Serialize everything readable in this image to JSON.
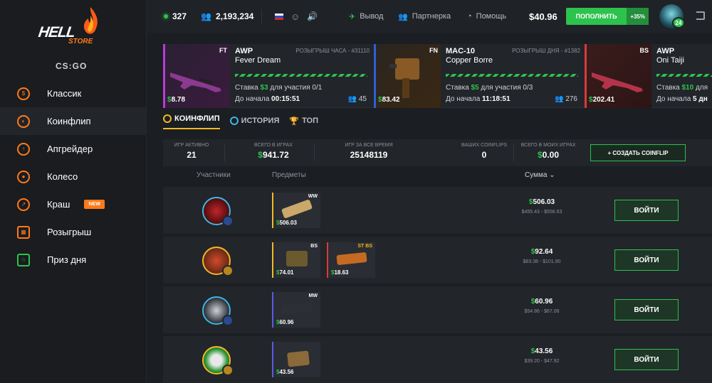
{
  "brand": {
    "logo_hell": "HELL",
    "logo_store": "STORE",
    "game": "CS:GO"
  },
  "sidebar": {
    "items": [
      {
        "label": "Классик"
      },
      {
        "label": "Коинфлип"
      },
      {
        "label": "Апгрейдер"
      },
      {
        "label": "Колесо"
      },
      {
        "label": "Краш",
        "badge": "NEW"
      },
      {
        "label": "Розыгрыш"
      },
      {
        "label": "Приз дня"
      }
    ]
  },
  "topbar": {
    "online": "327",
    "users": "2,193,234",
    "withdraw": "Вывод",
    "partner": "Партнерка",
    "help": "Помощь",
    "balance": "$40.96",
    "deposit_label": "ПОПОЛНИТЬ",
    "deposit_bonus": "+35%",
    "level": "24"
  },
  "giveaways": [
    {
      "wear": "FT",
      "price": "8.78",
      "name": "AWP",
      "skin": "Fever Dream",
      "type": "РОЗЫГРЫШ ЧАСА - #31110",
      "bet_pre": "Ставка ",
      "bet": "$3",
      "bet_post": " для участия 0/1",
      "time_pre": "До начала ",
      "time": "00:15:51",
      "count": "45"
    },
    {
      "wear": "FN",
      "price": "83.42",
      "name": "MAC-10",
      "skin": "Copper Borre",
      "type": "РОЗЫГРЫШ ДНЯ - #1382",
      "bet_pre": "Ставка ",
      "bet": "$5",
      "bet_post": " для участия 0/3",
      "time_pre": "До начала ",
      "time": "11:18:51",
      "count": "276"
    },
    {
      "wear": "BS",
      "price": "202.41",
      "name": "AWP",
      "skin": "Oni Taiji",
      "type": "",
      "bet_pre": "Ставка ",
      "bet": "$10",
      "bet_post": " для",
      "time_pre": "До начала ",
      "time": "5 дн",
      "count": ""
    }
  ],
  "tabs": [
    {
      "label": "КОИНФЛИП"
    },
    {
      "label": "ИСТОРИЯ"
    },
    {
      "label": "ТОП"
    }
  ],
  "stats": {
    "active_label": "ИГР АКТИВНО",
    "active": "21",
    "total_label": "ВСЕГО В ИГРАХ",
    "total": "941.72",
    "alltime_label": "ИГР ЗА ВСЕ ВРЕМЯ",
    "alltime": "25148119",
    "yours_label": "ВАШИХ COINFLIPS",
    "yours": "0",
    "mine_label": "ВСЕГО В МОИХ ИГРАХ",
    "mine": "0.00",
    "create": "+ СОЗДАТЬ COINFLIP"
  },
  "table": {
    "participants": "Участники",
    "items": "Предметы",
    "sum": "Сумма ⌄",
    "join": "ВОЙТИ",
    "rows": [
      {
        "items": [
          {
            "w": "WW",
            "p": "506.03"
          }
        ],
        "amount": "506.03",
        "range": "$455.43 - $556.63"
      },
      {
        "items": [
          {
            "w": "BS",
            "p": "74.01"
          },
          {
            "w": "ST BS",
            "p": "18.63"
          }
        ],
        "amount": "92.64",
        "range": "$83.38 - $101.90"
      },
      {
        "items": [
          {
            "w": "MW",
            "p": "60.96"
          }
        ],
        "amount": "60.96",
        "range": "$54.86 - $67.06"
      },
      {
        "items": [
          {
            "w": "",
            "p": "43.56"
          }
        ],
        "amount": "43.56",
        "range": "$39.20 - $47.92"
      }
    ]
  }
}
